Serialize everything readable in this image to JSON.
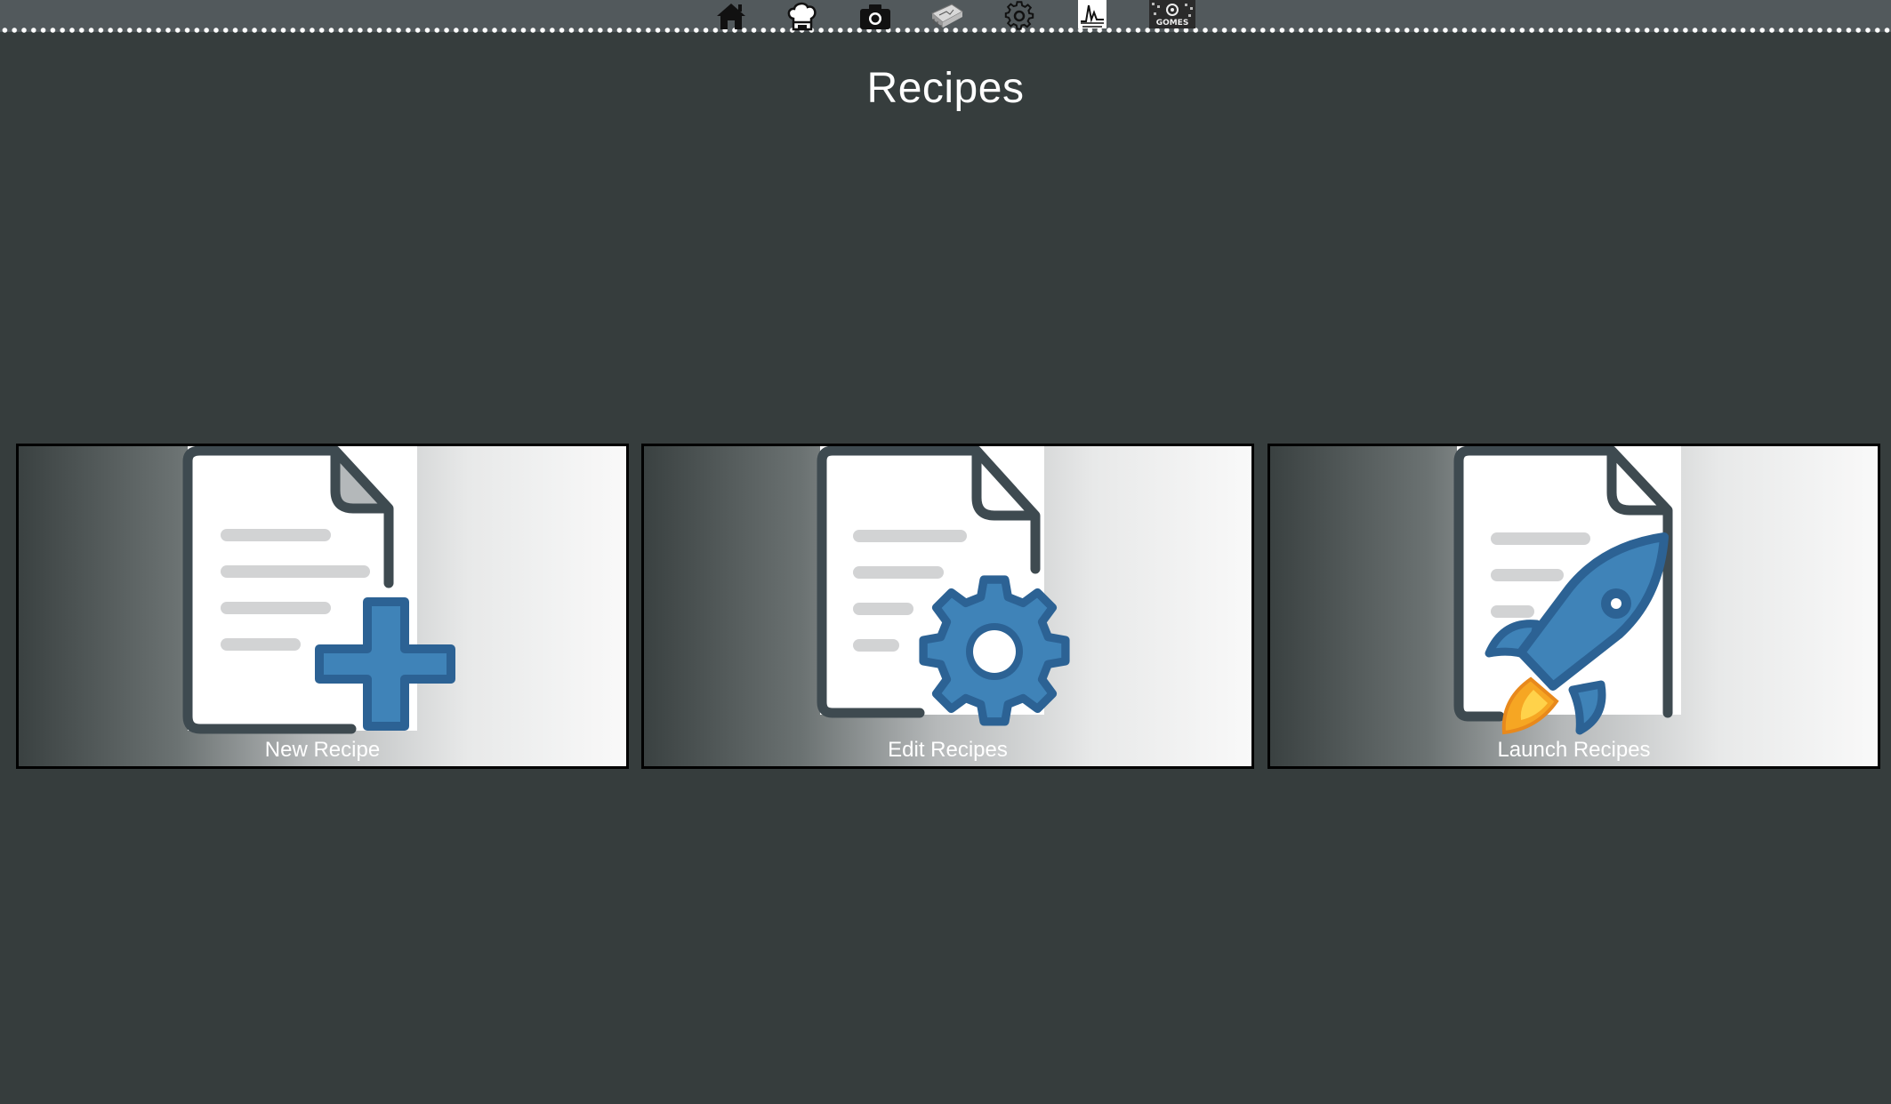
{
  "nav": {
    "icons": [
      {
        "name": "home-icon"
      },
      {
        "name": "chef-hat-icon"
      },
      {
        "name": "camera-icon"
      },
      {
        "name": "chip-icon"
      },
      {
        "name": "gear-icon"
      },
      {
        "name": "chart-icon"
      },
      {
        "name": "gomes-logo-icon"
      }
    ]
  },
  "page": {
    "title": "Recipes"
  },
  "tiles": [
    {
      "label": "New Recipe",
      "icon": "document-plus-icon"
    },
    {
      "label": "Edit Recipes",
      "icon": "document-gear-icon"
    },
    {
      "label": "Launch Recipes",
      "icon": "document-rocket-icon"
    }
  ],
  "colors": {
    "background": "#363d3d",
    "topbar": "#52595c",
    "accent_blue": "#3f83b8",
    "accent_blue_dark": "#2c6294",
    "doc_outline": "#3e4a50",
    "flame_orange": "#f6a623"
  }
}
